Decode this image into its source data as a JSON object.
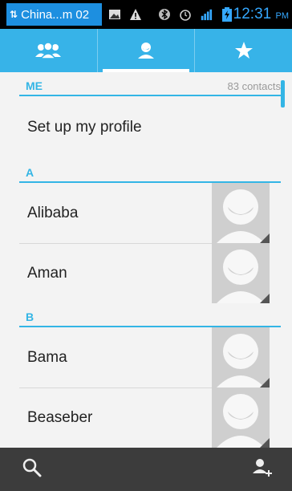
{
  "status_bar": {
    "carrier_text": "China...m 02",
    "sync_glyph": "⇅",
    "time": "12:31",
    "ampm": "PM",
    "icons": [
      "sync-icon",
      "image-icon",
      "warning-icon",
      "bluetooth-icon",
      "alarm-icon",
      "signal-icon",
      "battery-icon"
    ]
  },
  "tabs": [
    {
      "name": "groups",
      "icon": "groups-icon",
      "active": false
    },
    {
      "name": "contacts",
      "icon": "person-icon",
      "active": true
    },
    {
      "name": "favorites",
      "icon": "star-icon",
      "active": false
    }
  ],
  "me_section": {
    "title": "ME",
    "count": "83 contacts",
    "profile_label": "Set up my profile"
  },
  "sections": [
    {
      "letter": "A",
      "contacts": [
        "Alibaba",
        "Aman"
      ]
    },
    {
      "letter": "B",
      "contacts": [
        "Bama",
        "Beaseber"
      ]
    }
  ],
  "bottom_bar": {
    "left_icon": "search-icon",
    "right_icon": "add-contact-icon"
  },
  "colors": {
    "accent": "#33b5e5",
    "tab_bar": "#37b3e8",
    "bottom_bar": "#3c3c3c"
  }
}
